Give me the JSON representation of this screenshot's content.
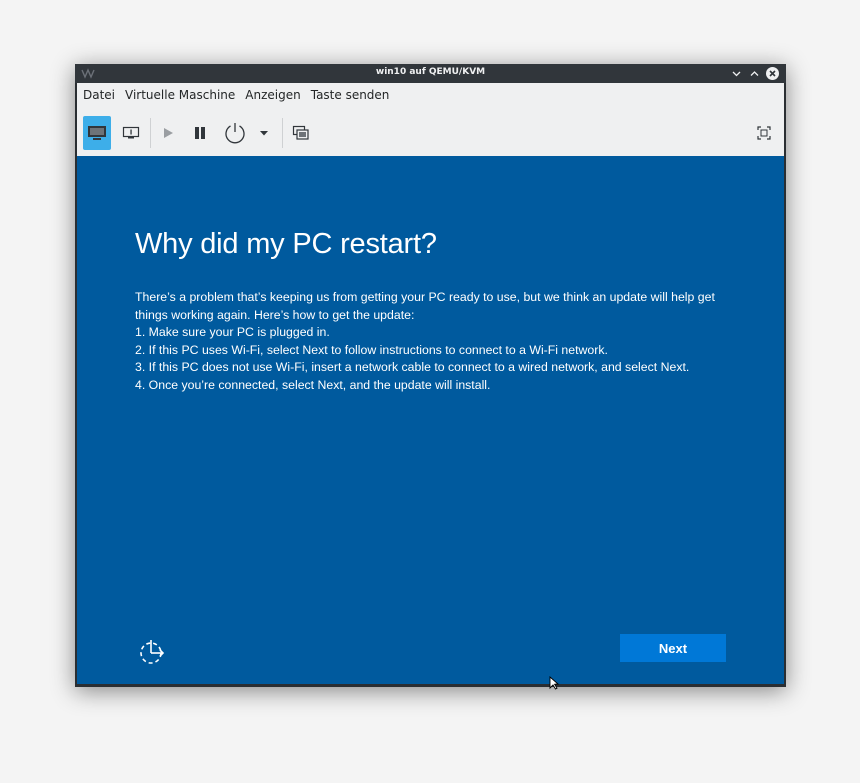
{
  "window": {
    "title": "win10 auf QEMU/KVM"
  },
  "menubar": {
    "items": [
      "Datei",
      "Virtuelle Maschine",
      "Anzeigen",
      "Taste senden"
    ]
  },
  "toolbar": {
    "icons": [
      "console-icon",
      "details-icon",
      "play-icon",
      "pause-icon",
      "power-icon",
      "dropdown-arrow-icon",
      "snapshots-icon",
      "fullscreen-icon"
    ]
  },
  "vm_screen": {
    "heading": "Why did my PC restart?",
    "paragraphs": [
      "There’s a problem that’s keeping us from getting your PC ready to use, but we think an update will help get things working again. Here’s how to get the update:",
      "1. Make sure your PC is plugged in.",
      "2. If this PC uses Wi-Fi, select Next to follow instructions to connect to a Wi-Fi network.",
      "3. If this PC does not use Wi-Fi, insert a network cable to connect to a wired network, and select Next.",
      "4. Once you’re connected, select Next, and the update will install."
    ],
    "next_label": "Next"
  },
  "colors": {
    "oobe_background": "#005a9e",
    "next_button": "#0078d7",
    "titlebar": "#31363b",
    "toolbar_active": "#3daee9"
  }
}
